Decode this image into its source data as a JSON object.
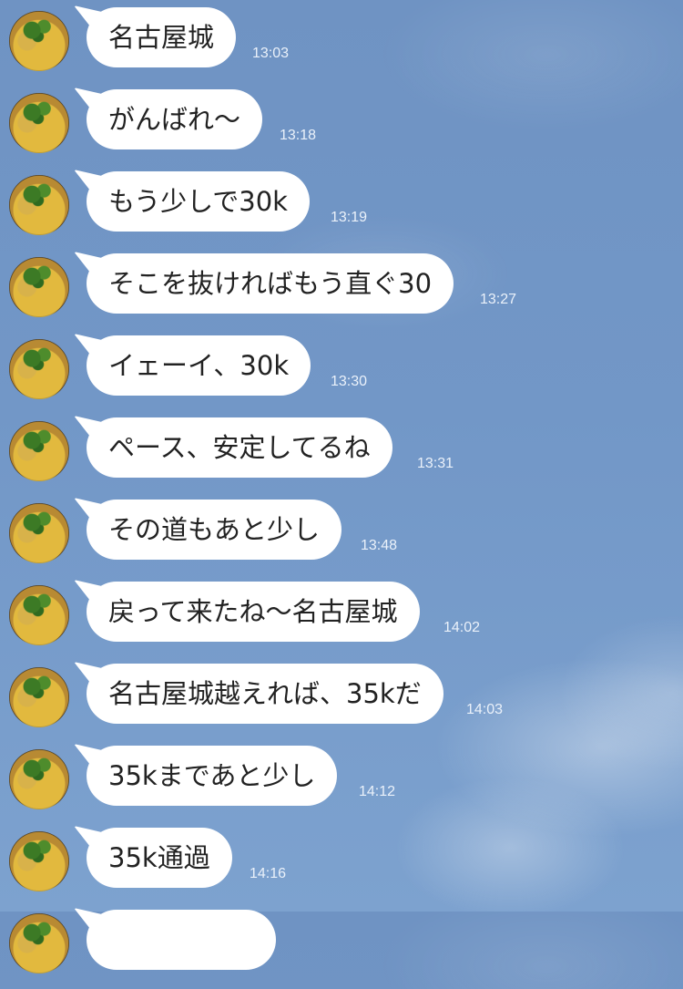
{
  "messages": [
    {
      "text": "名古屋城",
      "time": "13:03"
    },
    {
      "text": "がんばれ〜",
      "time": "13:18"
    },
    {
      "text": "もう少しで30k",
      "time": "13:19"
    },
    {
      "text": "そこを抜ければもう直ぐ30",
      "time": "13:27"
    },
    {
      "text": "イェーイ、30k",
      "time": "13:30"
    },
    {
      "text": "ペース、安定してるね",
      "time": "13:31"
    },
    {
      "text": "その道もあと少し",
      "time": "13:48"
    },
    {
      "text": "戻って来たね〜名古屋城",
      "time": "14:02"
    },
    {
      "text": "名古屋城越えれば、35kだ",
      "time": "14:03"
    },
    {
      "text": "35kまであと少し",
      "time": "14:12"
    },
    {
      "text": "35k通過",
      "time": "14:16"
    },
    {
      "text": "",
      "time": ""
    }
  ]
}
